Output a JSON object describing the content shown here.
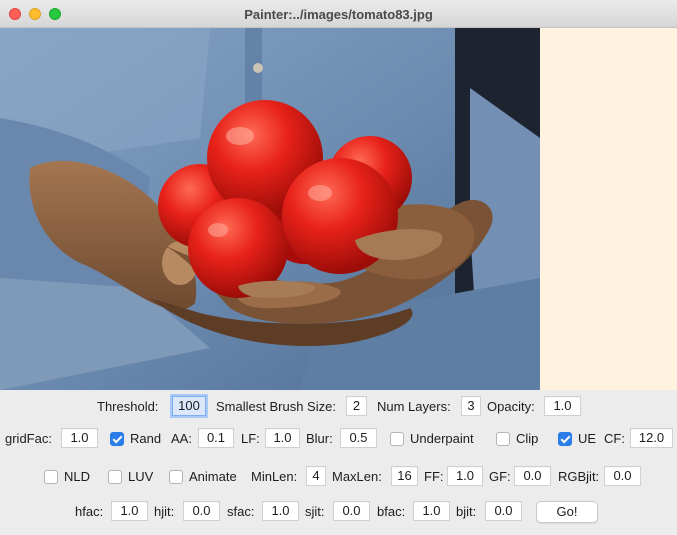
{
  "window": {
    "title": "Painter:../images/tomato83.jpg"
  },
  "image": {
    "description_icon": "photo-canvas"
  },
  "colors": {
    "panel": "#fff2df",
    "accent": "#2b7de9",
    "background": "#ececec"
  },
  "row1": {
    "threshold_label": "Threshold:",
    "threshold": "100",
    "brush_label": "Smallest Brush Size:",
    "brush": "2",
    "layers_label": "Num Layers:",
    "layers": "3",
    "opacity_label": "Opacity:",
    "opacity": "1.0"
  },
  "row2": {
    "gridfac_label": "gridFac:",
    "gridfac": "1.0",
    "rand_label": "Rand",
    "rand_checked": true,
    "aa_label": "AA:",
    "aa": "0.1",
    "lf_label": "LF:",
    "lf": "1.0",
    "blur_label": "Blur:",
    "blur": "0.5",
    "underpaint_label": "Underpaint",
    "underpaint_checked": false,
    "clip_label": "Clip",
    "clip_checked": false,
    "ue_label": "UE",
    "ue_checked": true,
    "cf_label": "CF:",
    "cf": "12.0"
  },
  "row3": {
    "nld_label": "NLD",
    "nld_checked": false,
    "luv_label": "LUV",
    "luv_checked": false,
    "animate_label": "Animate",
    "animate_checked": false,
    "minlen_label": "MinLen:",
    "minlen": "4",
    "maxlen_label": "MaxLen:",
    "maxlen": "16",
    "ff_label": "FF:",
    "ff": "1.0",
    "gf_label": "GF:",
    "gf": "0.0",
    "rgbjit_label": "RGBjit:",
    "rgbjit": "0.0"
  },
  "row4": {
    "hfac_label": "hfac:",
    "hfac": "1.0",
    "hjit_label": "hjit:",
    "hjit": "0.0",
    "sfac_label": "sfac:",
    "sfac": "1.0",
    "sjit_label": "sjit:",
    "sjit": "0.0",
    "bfac_label": "bfac:",
    "bfac": "1.0",
    "bjit_label": "bjit:",
    "bjit": "0.0",
    "go_label": "Go!"
  }
}
